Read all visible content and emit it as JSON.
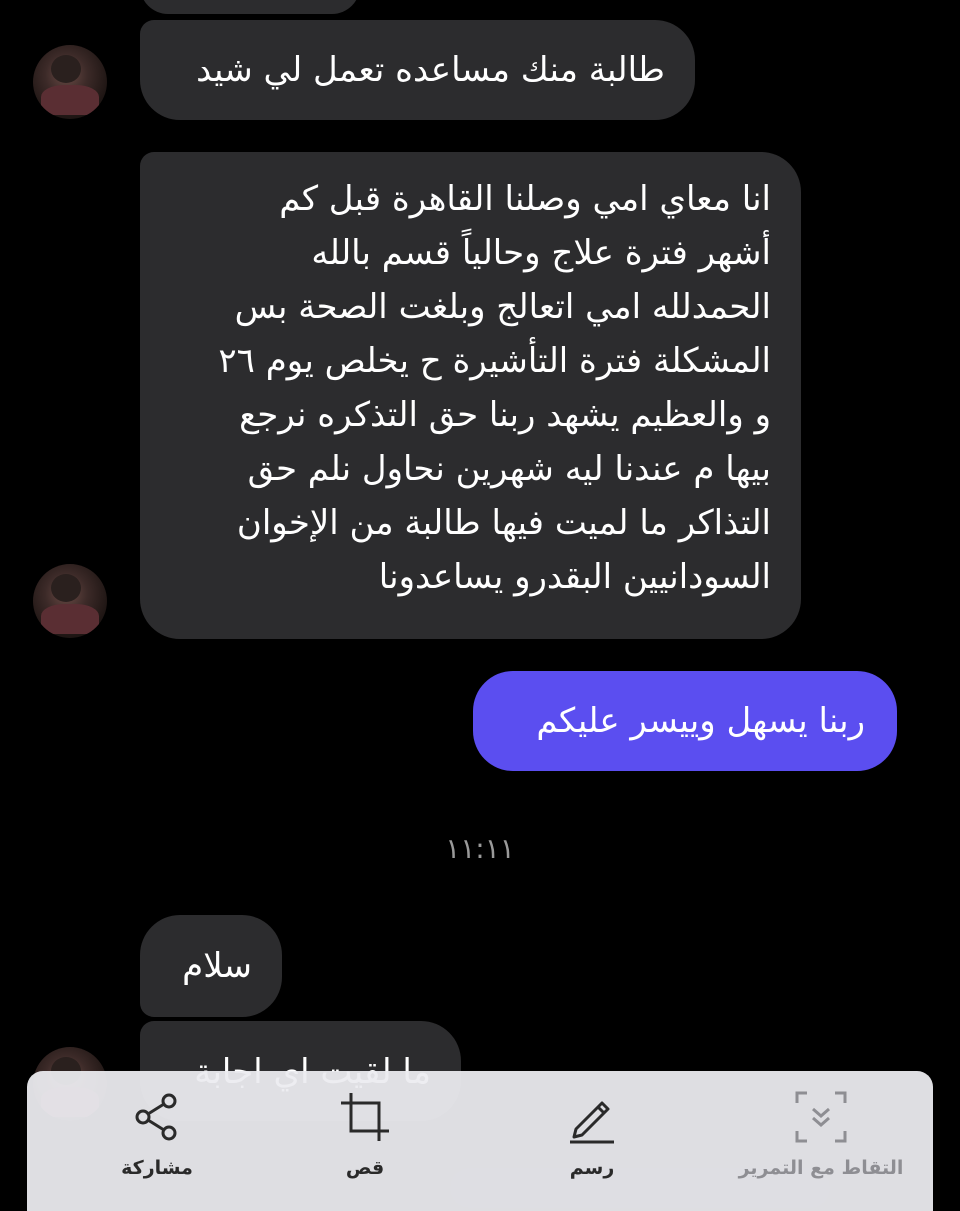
{
  "conversation": {
    "messages": [
      {
        "sender": "other",
        "text": "طالبة منك مساعده تعمل لي شيد"
      },
      {
        "sender": "other",
        "lines": [
          "انا معاي امي وصلنا القاهرة قبل كم",
          "أشهر فترة علاج وحالياً قسم بالله",
          "الحمدلله امي اتعالج وبلغت الصحة بس",
          "المشكلة فترة التأشيرة ح يخلص يوم ٢٦",
          "و والعظيم يشهد ربنا حق التذكره نرجع",
          "بيها م عندنا ليه شهرين نحاول نلم حق",
          "التذاكر ما لميت فيها طالبة من الإخوان",
          "السودانيين البقدرو يساعدونا"
        ]
      },
      {
        "sender": "me",
        "text": "ربنا يسهل وييسر عليكم"
      },
      {
        "sender": "other",
        "text": "سلام"
      },
      {
        "sender": "other",
        "text": "ما لقيت اي اجابة"
      }
    ],
    "timestamp": "١١:١١"
  },
  "toolbar": {
    "share": {
      "label": "مشاركة",
      "icon": "share-icon"
    },
    "crop": {
      "label": "قص",
      "icon": "crop-icon"
    },
    "draw": {
      "label": "رسم",
      "icon": "pencil-icon"
    },
    "scroll_capture": {
      "label": "التقاط مع التمرير",
      "icon": "scroll-capture-icon"
    }
  },
  "colors": {
    "background": "#000000",
    "incoming_bubble": "#2c2c2e",
    "outgoing_bubble": "#5b4ef0",
    "toolbar": "#ececf0"
  }
}
